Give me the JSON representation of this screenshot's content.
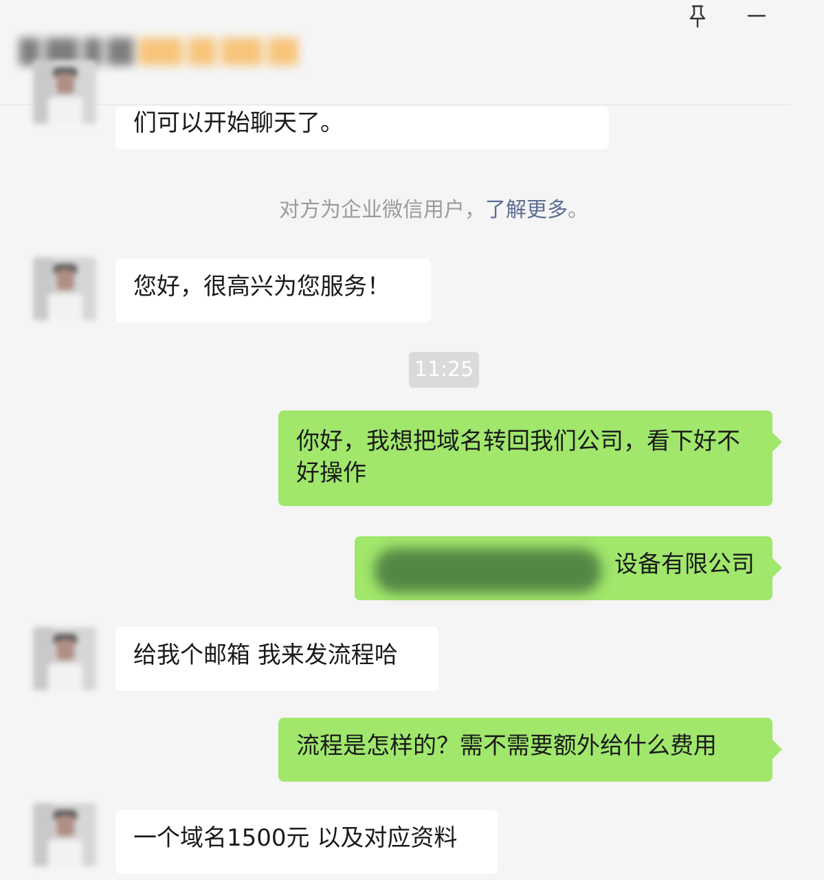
{
  "window": {
    "contact_name": "",
    "pin_icon": "pin-icon",
    "minimize_icon": "minimize-icon"
  },
  "messages": [
    {
      "side": "in",
      "text": "们可以开始聊天了。"
    },
    {
      "side": "in",
      "text": "您好，很高兴为您服务！"
    },
    {
      "side": "out",
      "text": "你好，我想把域名转回我们公司，看下好不好操作"
    },
    {
      "side": "out",
      "text": "设备有限公司"
    },
    {
      "side": "in",
      "text": "给我个邮箱 我来发流程哈"
    },
    {
      "side": "out",
      "text": "流程是怎样的？需不需要额外给什么费用"
    },
    {
      "side": "in",
      "text": "一个域名1500元 以及对应资料"
    }
  ],
  "system_notice": {
    "text": "对方为企业微信用户，",
    "link": "了解更多",
    "suffix": "。"
  },
  "timestamp": "11:25",
  "colors": {
    "outgoing_bubble": "#a0e76c",
    "incoming_bubble": "#ffffff",
    "background": "#f5f5f5",
    "link": "#5b6c94"
  }
}
